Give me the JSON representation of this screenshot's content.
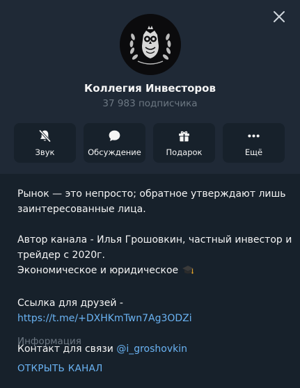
{
  "channel": {
    "title": "Коллегия Инвесторов",
    "subscribers": "37 983 подписчика"
  },
  "actions": [
    {
      "label": "Звук",
      "icon": "bell-off-icon"
    },
    {
      "label": "Обсуждение",
      "icon": "chat-bubble-icon"
    },
    {
      "label": "Подарок",
      "icon": "gift-icon"
    },
    {
      "label": "Ещё",
      "icon": "more-dots-icon"
    }
  ],
  "description": {
    "line1": "Рынок — это непросто; обратное утверждают лишь",
    "line2": "заинтересованные лица.",
    "author_line1": "Автор канала - Илья Грошовкин, частный инвестор и",
    "author_line2": "трейдер с 2020г.",
    "field_line": "Экономическое и юридическое",
    "friends_prefix": "Ссылка для друзей - ",
    "friends_link": "https://t.me/+DXHKmTwn7Ag3ODZi",
    "contact_prefix": "Контакт для связи ",
    "contact_handle": "@i_groshovkin"
  },
  "info_label": "Информация",
  "open_channel_label": "ОТКРЫТЬ КАНАЛ",
  "colors": {
    "background": "#17212b",
    "header": "#1f2936",
    "accent": "#6ab3f3",
    "muted": "#6d7883"
  }
}
